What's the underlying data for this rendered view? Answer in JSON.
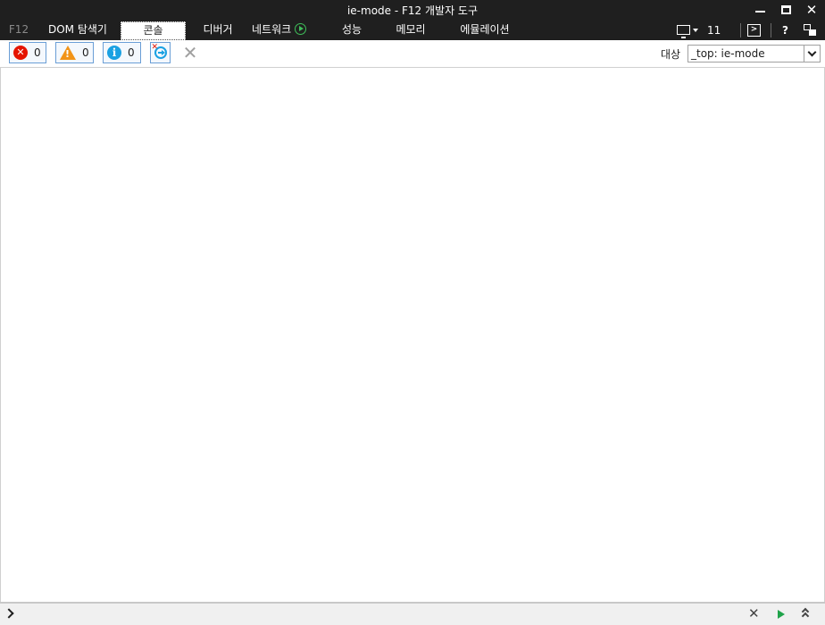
{
  "window": {
    "title": "ie-mode - F12 개발자 도구"
  },
  "tabs": [
    {
      "label": "F12"
    },
    {
      "label": "DOM 탐색기"
    },
    {
      "label": "콘솔",
      "selected": true
    },
    {
      "label": "디버거"
    },
    {
      "label": "네트워크"
    },
    {
      "label": "성능"
    },
    {
      "label": "메모리"
    },
    {
      "label": "에뮬레이션"
    }
  ],
  "toolbar_right": {
    "document_mode": "11",
    "help": "?"
  },
  "console_toolbar": {
    "errors_count": "0",
    "warnings_count": "0",
    "messages_count": "0",
    "target_label": "대상",
    "target_value": "_top: ie-mode"
  },
  "colors": {
    "titlebar_bg": "#1f1f1f",
    "error": "#e51400",
    "warning": "#f29418",
    "info": "#1ba1e2",
    "run": "#1fa34a"
  },
  "icons": {
    "network_profiling": "play-circle-icon",
    "document_mode": "monitor-icon",
    "console_toggle": "console-icon",
    "dock": "dock-icon"
  }
}
